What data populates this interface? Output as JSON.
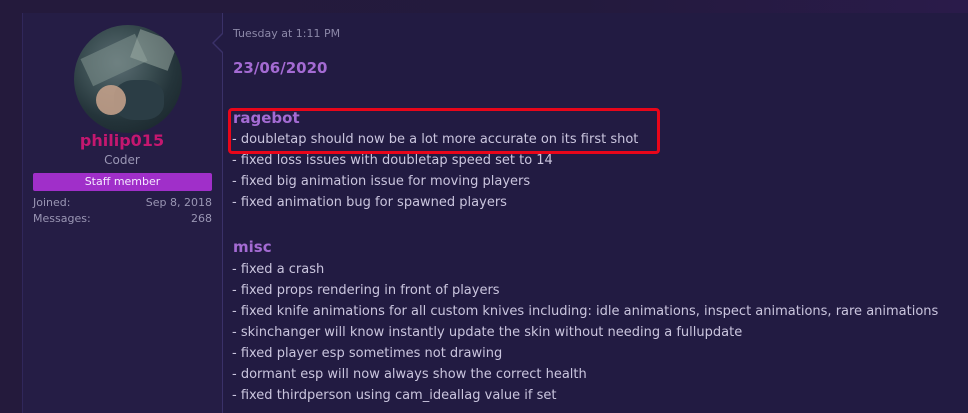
{
  "author": {
    "username": "philip015",
    "role": "Coder",
    "badge": "Staff member",
    "joined_label": "Joined:",
    "joined_value": "Sep 8, 2018",
    "messages_label": "Messages:",
    "messages_value": "268"
  },
  "post": {
    "timestamp": "Tuesday at 1:11 PM",
    "date_heading": "23/06/2020",
    "sections": [
      {
        "title": "ragebot",
        "items": [
          "- doubletap should now be a lot more accurate on its first shot",
          "- fixed loss issues with doubletap speed set to 14",
          "- fixed big animation issue for moving players",
          "- fixed animation bug for spawned players"
        ]
      },
      {
        "title": "misc",
        "items": [
          "- fixed a crash",
          "- fixed props rendering in front of players",
          "- fixed knife animations for all custom knives including: idle animations, inspect animations, rare animations",
          "- skinchanger will know instantly update the skin without needing a fullupdate",
          "- fixed player esp sometimes not drawing",
          "- dormant esp will now always show the correct health",
          "- fixed thirdperson using cam_ideallag value if set"
        ]
      }
    ]
  },
  "colors": {
    "username": "#c4176f",
    "heading": "#a46bd3",
    "badge_bg": "#a02fc9",
    "highlight_border": "#e8061a"
  }
}
